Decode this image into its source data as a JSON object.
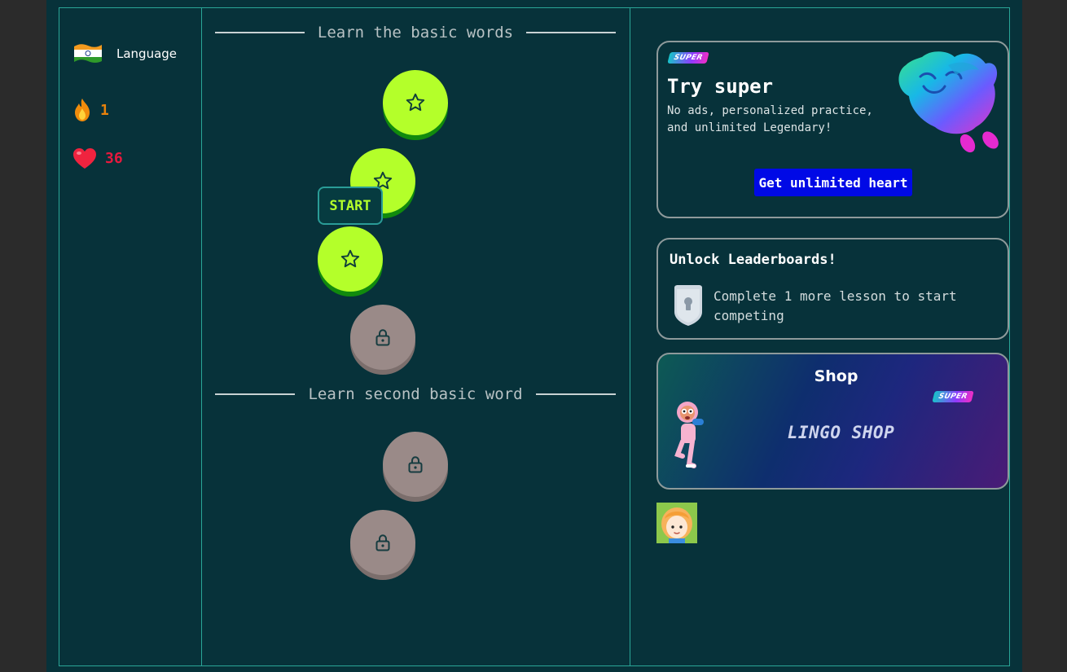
{
  "sidebar": {
    "language_label": "Language",
    "language_flag": "india-flag-icon",
    "streak": {
      "icon": "fire-icon",
      "value": "1",
      "color": "#e8820b"
    },
    "hearts": {
      "icon": "heart-icon",
      "value": "36",
      "color": "#e8193e"
    }
  },
  "path": {
    "sections": [
      {
        "title": "Learn the basic words"
      },
      {
        "title": "Learn second basic word"
      }
    ],
    "start_label": "START",
    "nodes": [
      {
        "section": 0,
        "status": "active",
        "icon": "star-icon"
      },
      {
        "section": 0,
        "status": "active",
        "icon": "star-icon"
      },
      {
        "section": 0,
        "status": "active",
        "icon": "star-icon"
      },
      {
        "section": 0,
        "status": "locked",
        "icon": "lock-icon"
      },
      {
        "section": 1,
        "status": "locked",
        "icon": "lock-icon"
      },
      {
        "section": 1,
        "status": "locked",
        "icon": "lock-icon"
      }
    ]
  },
  "super_card": {
    "badge": "SUPER",
    "title": "Try super",
    "description": "No ads, personalized practice, and unlimited Legendary!",
    "button_label": "Get unlimited heart",
    "mascot_icon": "super-mascot-icon"
  },
  "leaderboard_card": {
    "title": "Unlock Leaderboards!",
    "description": "Complete 1 more lesson to start competing",
    "icon": "locked-shield-icon"
  },
  "shop_card": {
    "title": "Shop",
    "badge": "SUPER",
    "name": "LINGO SHOP",
    "character_icon": "shop-character-icon"
  },
  "profile": {
    "avatar_icon": "user-avatar-icon"
  },
  "colors": {
    "background": "#07323a",
    "border": "#2aa597",
    "node_active": "#b4ff2a",
    "node_locked": "#9a8a88",
    "button_blue": "#0009e6"
  }
}
